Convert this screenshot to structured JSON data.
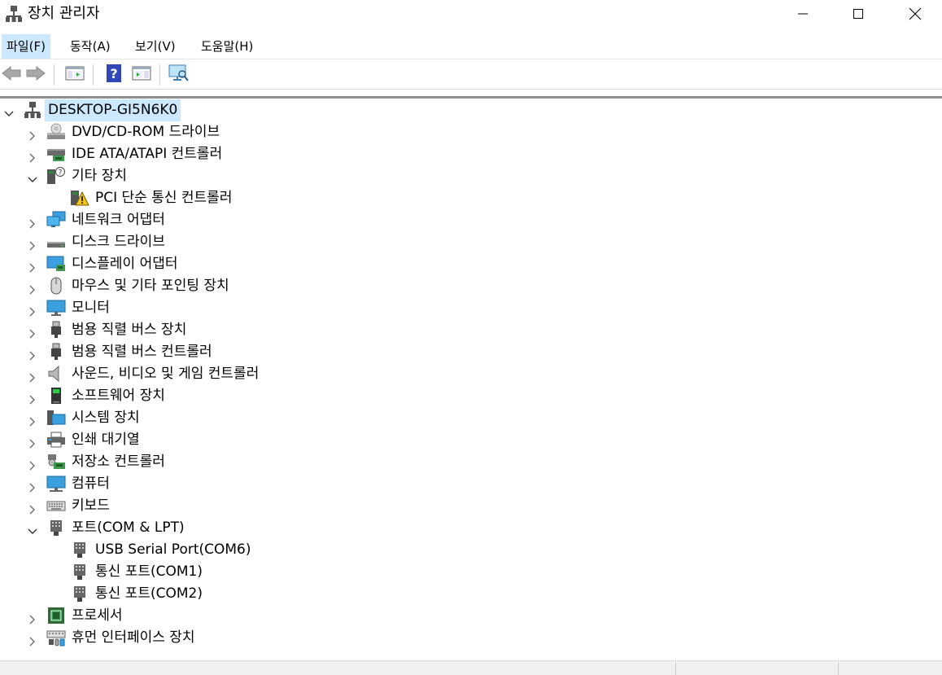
{
  "window": {
    "title": "장치 관리자",
    "icon": "device-manager-icon",
    "controls": [
      "minimize-icon",
      "maximize-icon",
      "close-icon"
    ]
  },
  "menubar": {
    "items": [
      {
        "label": "파일(F)"
      },
      {
        "label": "동작(A)"
      },
      {
        "label": "보기(V)"
      },
      {
        "label": "도움말(H)"
      }
    ]
  },
  "toolbar": {
    "buttons": [
      "back-arrow-icon",
      "forward-arrow-icon",
      "show-hide-console-tree-icon",
      "help-icon",
      "properties-icon",
      "scan-hardware-icon"
    ]
  },
  "tree": {
    "root": {
      "label": "DESKTOP-GI5N6K0",
      "icon": "computer-network-icon",
      "expanded": true
    },
    "nodes": [
      {
        "label": "DVD/CD-ROM 드라이브",
        "icon": "dvd-drive-icon",
        "level": 1,
        "expander": "collapsed"
      },
      {
        "label": "IDE ATA/ATAPI 컨트롤러",
        "icon": "ide-controller-icon",
        "level": 1,
        "expander": "collapsed"
      },
      {
        "label": "기타 장치",
        "icon": "other-devices-icon",
        "level": 1,
        "expander": "expanded"
      },
      {
        "label": "PCI 단순 통신 컨트롤러",
        "icon": "warning-device-icon",
        "level": 2,
        "expander": "none"
      },
      {
        "label": "네트워크 어댑터",
        "icon": "network-adapter-icon",
        "level": 1,
        "expander": "collapsed"
      },
      {
        "label": "디스크 드라이브",
        "icon": "disk-drive-icon",
        "level": 1,
        "expander": "collapsed"
      },
      {
        "label": "디스플레이 어댑터",
        "icon": "display-adapter-icon",
        "level": 1,
        "expander": "collapsed"
      },
      {
        "label": "마우스 및 기타 포인팅 장치",
        "icon": "mouse-icon",
        "level": 1,
        "expander": "collapsed"
      },
      {
        "label": "모니터",
        "icon": "monitor-icon",
        "level": 1,
        "expander": "collapsed"
      },
      {
        "label": "범용 직렬 버스 장치",
        "icon": "usb-icon",
        "level": 1,
        "expander": "collapsed"
      },
      {
        "label": "범용 직렬 버스 컨트롤러",
        "icon": "usb-controller-icon",
        "level": 1,
        "expander": "collapsed"
      },
      {
        "label": "사운드, 비디오 및 게임 컨트롤러",
        "icon": "speaker-icon",
        "level": 1,
        "expander": "collapsed"
      },
      {
        "label": "소프트웨어 장치",
        "icon": "software-device-icon",
        "level": 1,
        "expander": "collapsed"
      },
      {
        "label": "시스템 장치",
        "icon": "system-device-icon",
        "level": 1,
        "expander": "collapsed"
      },
      {
        "label": "인쇄 대기열",
        "icon": "printer-icon",
        "level": 1,
        "expander": "collapsed"
      },
      {
        "label": "저장소 컨트롤러",
        "icon": "storage-controller-icon",
        "level": 1,
        "expander": "collapsed"
      },
      {
        "label": "컴퓨터",
        "icon": "computer-icon",
        "level": 1,
        "expander": "collapsed"
      },
      {
        "label": "키보드",
        "icon": "keyboard-icon",
        "level": 1,
        "expander": "collapsed"
      },
      {
        "label": "포트(COM & LPT)",
        "icon": "port-icon",
        "level": 1,
        "expander": "expanded"
      },
      {
        "label": "USB Serial Port(COM6)",
        "icon": "port-icon",
        "level": 2,
        "expander": "none"
      },
      {
        "label": "통신 포트(COM1)",
        "icon": "port-icon",
        "level": 2,
        "expander": "none"
      },
      {
        "label": "통신 포트(COM2)",
        "icon": "port-icon",
        "level": 2,
        "expander": "none"
      },
      {
        "label": "프로세서",
        "icon": "processor-icon",
        "level": 1,
        "expander": "collapsed"
      },
      {
        "label": "휴먼 인터페이스 장치",
        "icon": "hid-icon",
        "level": 1,
        "expander": "collapsed"
      }
    ]
  },
  "colors": {
    "selection": "#cce8ff",
    "menu_active": "#cce8ff",
    "tree_border": "#8f8f8f"
  }
}
